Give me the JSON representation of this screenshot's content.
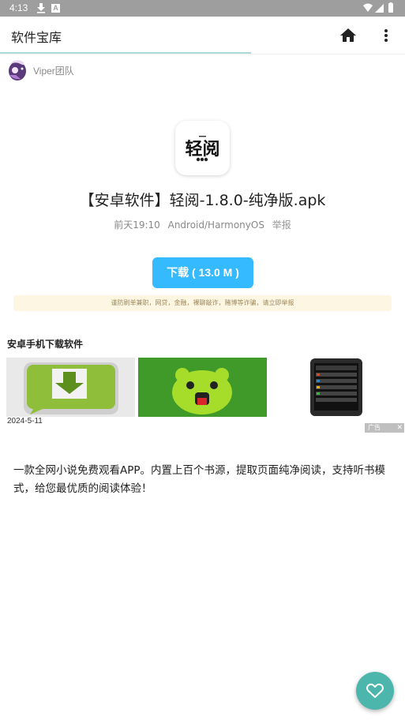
{
  "status_bar": {
    "time": "4:13",
    "notification_letter": "A"
  },
  "app_bar": {
    "title": "软件宝库",
    "actions": [
      "home-icon",
      "more-vert-icon"
    ]
  },
  "author": {
    "name": "Viper团队"
  },
  "app": {
    "icon_text": "轻阅",
    "title": "【安卓软件】轻阅-1.8.0-纯净版.apk",
    "date": "前天19:10",
    "platform": "Android/HarmonyOS",
    "report_label": "举报"
  },
  "download": {
    "label": "下载 ( 13.0 M )"
  },
  "warning": {
    "text": "谨防刷单兼职，网贷，金融，裸聊敲诈，赌博等诈骗，请立即举报"
  },
  "ad": {
    "title": "安卓手机下载软件",
    "date": "2024-5-11",
    "badge": "广告",
    "close": "✕"
  },
  "description": {
    "text": "一款全网小说免费观看APP。内置上百个书源，提取页面纯净阅读，支持听书模式，给您最优质的阅读体验！"
  },
  "colors": {
    "accent": "#35b9ff",
    "fab": "#4db6ac",
    "status_bar": "#9e9e9e"
  }
}
